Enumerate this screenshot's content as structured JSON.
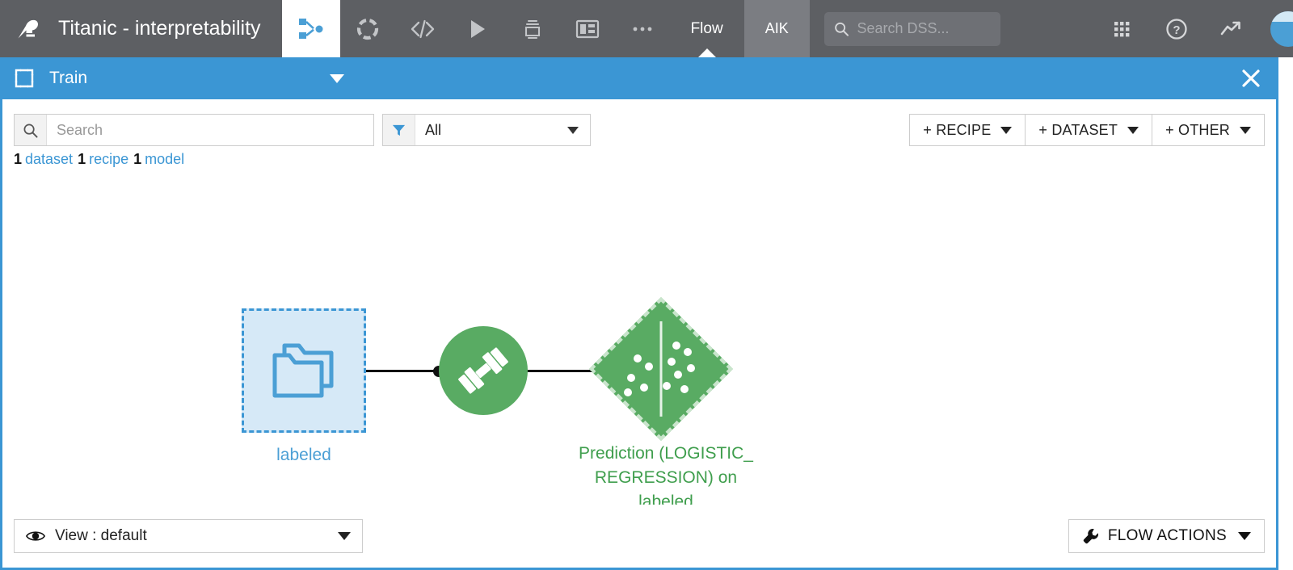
{
  "topbar": {
    "logo_icon": "dataiku-bird-logo",
    "project_title": "Titanic - interpretability",
    "flow_tab_icon": "flow-branch-icon",
    "icons": [
      {
        "name": "lab-icon",
        "label": "Lab"
      },
      {
        "name": "code-icon",
        "label": "Code"
      },
      {
        "name": "play-icon",
        "label": "Run"
      },
      {
        "name": "jobs-icon",
        "label": "Jobs"
      },
      {
        "name": "dashboard-icon",
        "label": "Dashboards"
      },
      {
        "name": "more-ellipsis-icon",
        "label": "More"
      }
    ],
    "flow_label": "Flow",
    "aik_label": "AIK",
    "search": {
      "placeholder": "Search DSS...",
      "value": "",
      "icon": "search-icon"
    },
    "apps_icon": "apps-grid-icon",
    "help_icon": "help-question-icon",
    "activity_icon": "trending-up-icon",
    "avatar_icon": "user-avatar",
    "accent_color": "#5d5f63"
  },
  "zone": {
    "icon": "zone-frame-icon",
    "name": "Train",
    "caret_icon": "chevron-down-icon",
    "close_icon": "close-icon",
    "color": "#3b96d4"
  },
  "toolbar": {
    "search": {
      "placeholder": "Search",
      "value": "",
      "icon": "search-icon"
    },
    "filter": {
      "icon": "filter-funnel-icon",
      "value": "All",
      "caret_icon": "chevron-down-icon"
    },
    "buttons": [
      {
        "label": "+ RECIPE",
        "name": "add-recipe-button"
      },
      {
        "label": "+ DATASET",
        "name": "add-dataset-button"
      },
      {
        "label": "+ OTHER",
        "name": "add-other-button"
      }
    ]
  },
  "counts": {
    "dataset_count": "1",
    "dataset_label": "dataset",
    "recipe_count": "1",
    "recipe_label": "recipe",
    "model_count": "1",
    "model_label": "model",
    "link_color": "#3b96d4"
  },
  "flow": {
    "dataset_node": {
      "icon": "managed-folder-icon",
      "label": "labeled",
      "color": "#4b9fd5",
      "fill": "#d6e9f7"
    },
    "recipe_node": {
      "icon": "train-dumbbell-icon",
      "color": "#59ab63"
    },
    "model_node": {
      "icon": "saved-model-scatter-icon",
      "badge_icon": "info-icon",
      "label": "Prediction (LOGISTIC_REGRESSION) on labeled",
      "label_line1": "Prediction (LOGISTIC_",
      "label_line2": "REGRESSION) on",
      "label_line3": "labeled",
      "color": "#3f9e4d",
      "fill": "#59ab63"
    }
  },
  "bottombar": {
    "view": {
      "icon": "eye-icon",
      "label": "View : default",
      "caret_icon": "chevron-down-icon"
    },
    "flow_actions": {
      "icon": "wrench-icon",
      "label": "FLOW ACTIONS",
      "caret_icon": "chevron-down-icon"
    }
  }
}
